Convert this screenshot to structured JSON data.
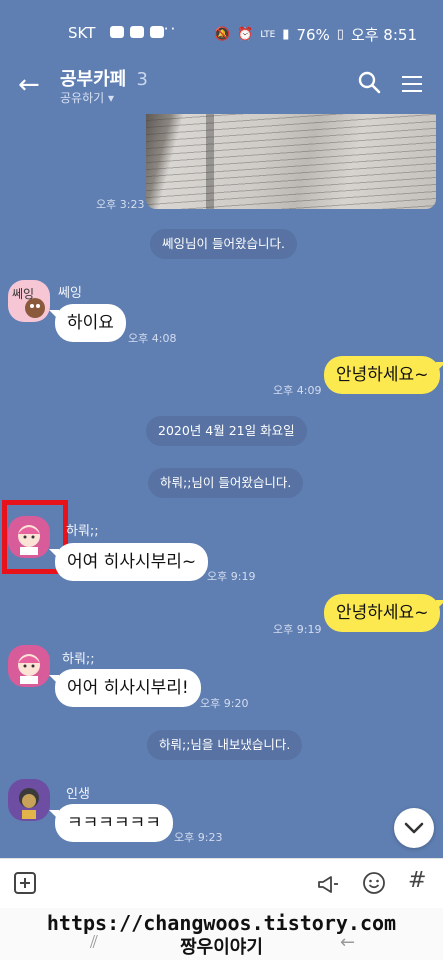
{
  "status_bar": {
    "carrier": "SKT",
    "dots": "···",
    "battery": "76%",
    "time": "오후 8:51",
    "network": "LTE"
  },
  "header": {
    "title": "공부카페",
    "member_count": "3",
    "subtitle": "공유하기 ▾"
  },
  "messages": {
    "photo_time": "오후 3:23",
    "notice1": "쎄잉님이 들어왔습니다.",
    "m1": {
      "sender": "쎄잉",
      "avatar_text": "쎄잉",
      "text": "하이요",
      "time": "오후 4:08"
    },
    "m2": {
      "text": "안녕하세요~",
      "time": "오후 4:09"
    },
    "date": "2020년 4월 21일 화요일",
    "notice2": "하뤄;;님이 들어왔습니다.",
    "m3": {
      "sender": "하뤄;;",
      "text": "어여 히사시부리~",
      "time": "오후 9:19"
    },
    "m4": {
      "text": "안녕하세요~",
      "time": "오후 9:19"
    },
    "m5": {
      "sender": "하뤄;;",
      "text": "어어 히사시부리!",
      "time": "오후 9:20"
    },
    "notice3": "하뤄;;님을 내보냈습니다.",
    "m6": {
      "sender": "인생",
      "text": "ㅋㅋㅋㅋㅋㅋ",
      "time": "오후 9:23"
    }
  },
  "watermark": {
    "url": "https://changwoos.tistory.com",
    "name": "짱우이야기"
  },
  "icons": [
    "back-arrow-icon",
    "search-icon",
    "menu-icon",
    "chevron-down-icon",
    "plus-icon",
    "megaphone-icon",
    "emoji-icon",
    "hash-icon"
  ],
  "colors": {
    "background": "#5f7fb3",
    "my_bubble": "#fce94f",
    "their_bubble": "#ffffff",
    "highlight": "#e8131a"
  }
}
